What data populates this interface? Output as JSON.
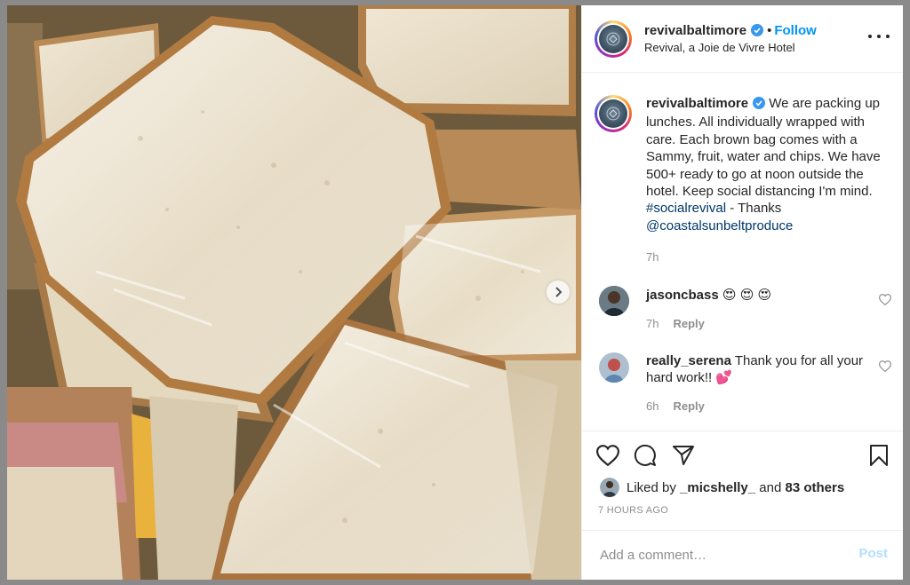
{
  "colors": {
    "accent": "#0095f6",
    "link": "#00376b",
    "muted": "#8e8e8e",
    "text": "#262626",
    "post_disabled": "#b2dffc",
    "emoji_heart_eyes": "#f5c518",
    "heart_pink": "#ff69b4"
  },
  "post": {
    "image_alt": "Plastic-wrapped sandwiches of white bread"
  },
  "header": {
    "username": "revivalbaltimore",
    "separator": "•",
    "follow_label": "Follow",
    "location": "Revival, a Joie de Vivre Hotel",
    "more_icon": "more-horizontal-icon"
  },
  "caption": {
    "username": "revivalbaltimore",
    "text": " We are packing up lunches. All individually wrapped with care. Each brown bag comes with a Sammy, fruit, water and chips. We have 500+ ready to go at noon outside the hotel. Keep social distancing I'm mind. ",
    "hashtag": "#socialrevival",
    "thanks": " - Thanks ",
    "mention": "@coastalsunbeltproduce",
    "time": "7h"
  },
  "comments": [
    {
      "username": "jasoncbass",
      "text": " 😍 😍 😍",
      "time": "7h",
      "reply_label": "Reply"
    },
    {
      "username": "really_serena",
      "text": " Thank you for all your hard work!! 💕",
      "time": "6h",
      "reply_label": "Reply"
    }
  ],
  "actions": {
    "icons": [
      "heart-icon",
      "comment-icon",
      "share-icon",
      "bookmark-icon"
    ],
    "liked_by_prefix": "Liked by ",
    "liked_by_user": "_micshelly_",
    "liked_by_and": " and ",
    "liked_by_others": "83 others",
    "timestamp": "7 HOURS AGO"
  },
  "add_comment": {
    "placeholder": "Add a comment…",
    "post_label": "Post"
  }
}
